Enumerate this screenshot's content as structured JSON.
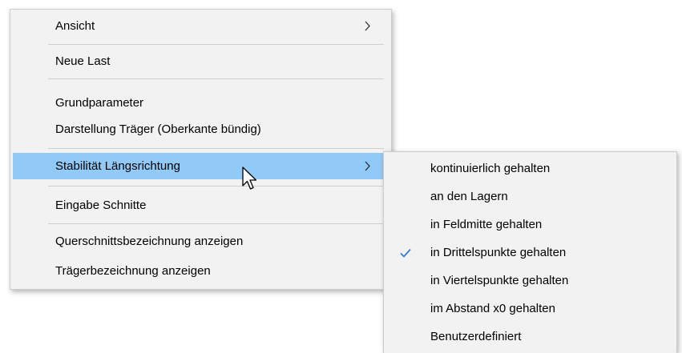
{
  "context_menu": {
    "items": [
      {
        "label": "Ansicht",
        "has_submenu": true
      },
      {
        "label": "Neue Last"
      },
      {
        "label": "Grundparameter"
      },
      {
        "label": "Darstellung Träger (Oberkante bündig)"
      },
      {
        "label": "Stabilität Längsrichtung",
        "has_submenu": true,
        "highlighted": true
      },
      {
        "label": "Eingabe Schnitte"
      },
      {
        "label": "Querschnittsbezeichnung anzeigen"
      },
      {
        "label": "Trägerbezeichnung anzeigen"
      }
    ]
  },
  "submenu": {
    "items": [
      {
        "label": "kontinuierlich gehalten"
      },
      {
        "label": "an den Lagern"
      },
      {
        "label": "in Feldmitte gehalten"
      },
      {
        "label": "in Drittelspunkte gehalten",
        "checked": true
      },
      {
        "label": "in Viertelspunkte gehalten"
      },
      {
        "label": "im Abstand x0 gehalten"
      },
      {
        "label": "Benutzerdefiniert"
      }
    ]
  },
  "colors": {
    "menu_background": "#f2f2f2",
    "highlight": "#91c9f7",
    "separator": "#cfcfcf",
    "checkmark": "#3a7bd5"
  },
  "icons": {
    "submenu_arrow": "chevron-right-icon",
    "check": "checkmark-icon",
    "cursor": "mouse-pointer-icon"
  }
}
